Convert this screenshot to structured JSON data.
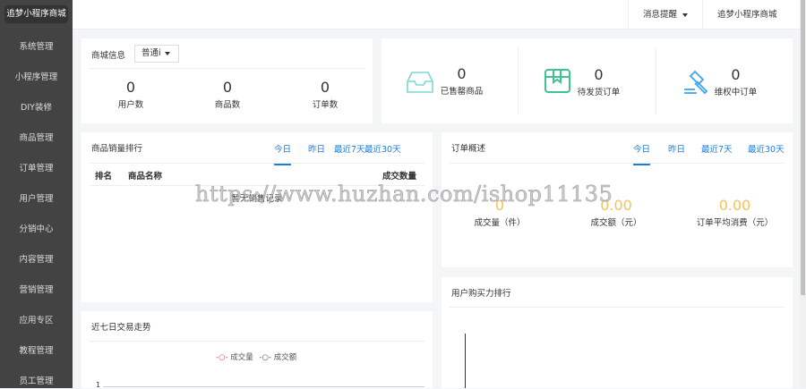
{
  "sidebar": {
    "logo": "追梦小程序商城",
    "items": [
      "系统管理",
      "小程序管理",
      "DIY装修",
      "商品管理",
      "订单管理",
      "用户管理",
      "分销中心",
      "内容管理",
      "营销管理",
      "应用专区",
      "教程管理",
      "员工管理"
    ]
  },
  "header": {
    "messages": "消息提醒",
    "store": "追梦小程序商城"
  },
  "store_info": {
    "title": "商城信息",
    "select": "普通i",
    "stats": [
      {
        "value": "0",
        "label": "用户数"
      },
      {
        "value": "0",
        "label": "商品数"
      },
      {
        "value": "0",
        "label": "订单数"
      }
    ]
  },
  "status": [
    {
      "value": "0",
      "label": "已售罄商品",
      "icon": "inbox-icon",
      "color": "#7dd8d0"
    },
    {
      "value": "0",
      "label": "待发货订单",
      "icon": "package-icon",
      "color": "#3dc48f"
    },
    {
      "value": "0",
      "label": "维权中订单",
      "icon": "gavel-icon",
      "color": "#3aa5f0"
    }
  ],
  "sales_rank": {
    "title": "商品销量排行",
    "tabs": [
      "今日",
      "昨日",
      "最近7天",
      "最近30天"
    ],
    "columns": [
      "排名",
      "商品名称",
      "成交数量"
    ],
    "empty": "暂无销售记录"
  },
  "order_overview": {
    "title": "订单概述",
    "tabs": [
      "今日",
      "昨日",
      "最近7天",
      "最近30天"
    ],
    "stats": [
      {
        "value": "0",
        "label": "成交量（件）"
      },
      {
        "value": "0.00",
        "label": "成交额（元）"
      },
      {
        "value": "0.00",
        "label": "订单平均消费（元）"
      }
    ]
  },
  "trend": {
    "title": "近七日交易走势",
    "legend": [
      "成交量",
      "成交额"
    ],
    "ytick": "1"
  },
  "user_rank": {
    "title": "用户购买力排行"
  },
  "watermark": "https://www.huzhan.com/ishop11135"
}
